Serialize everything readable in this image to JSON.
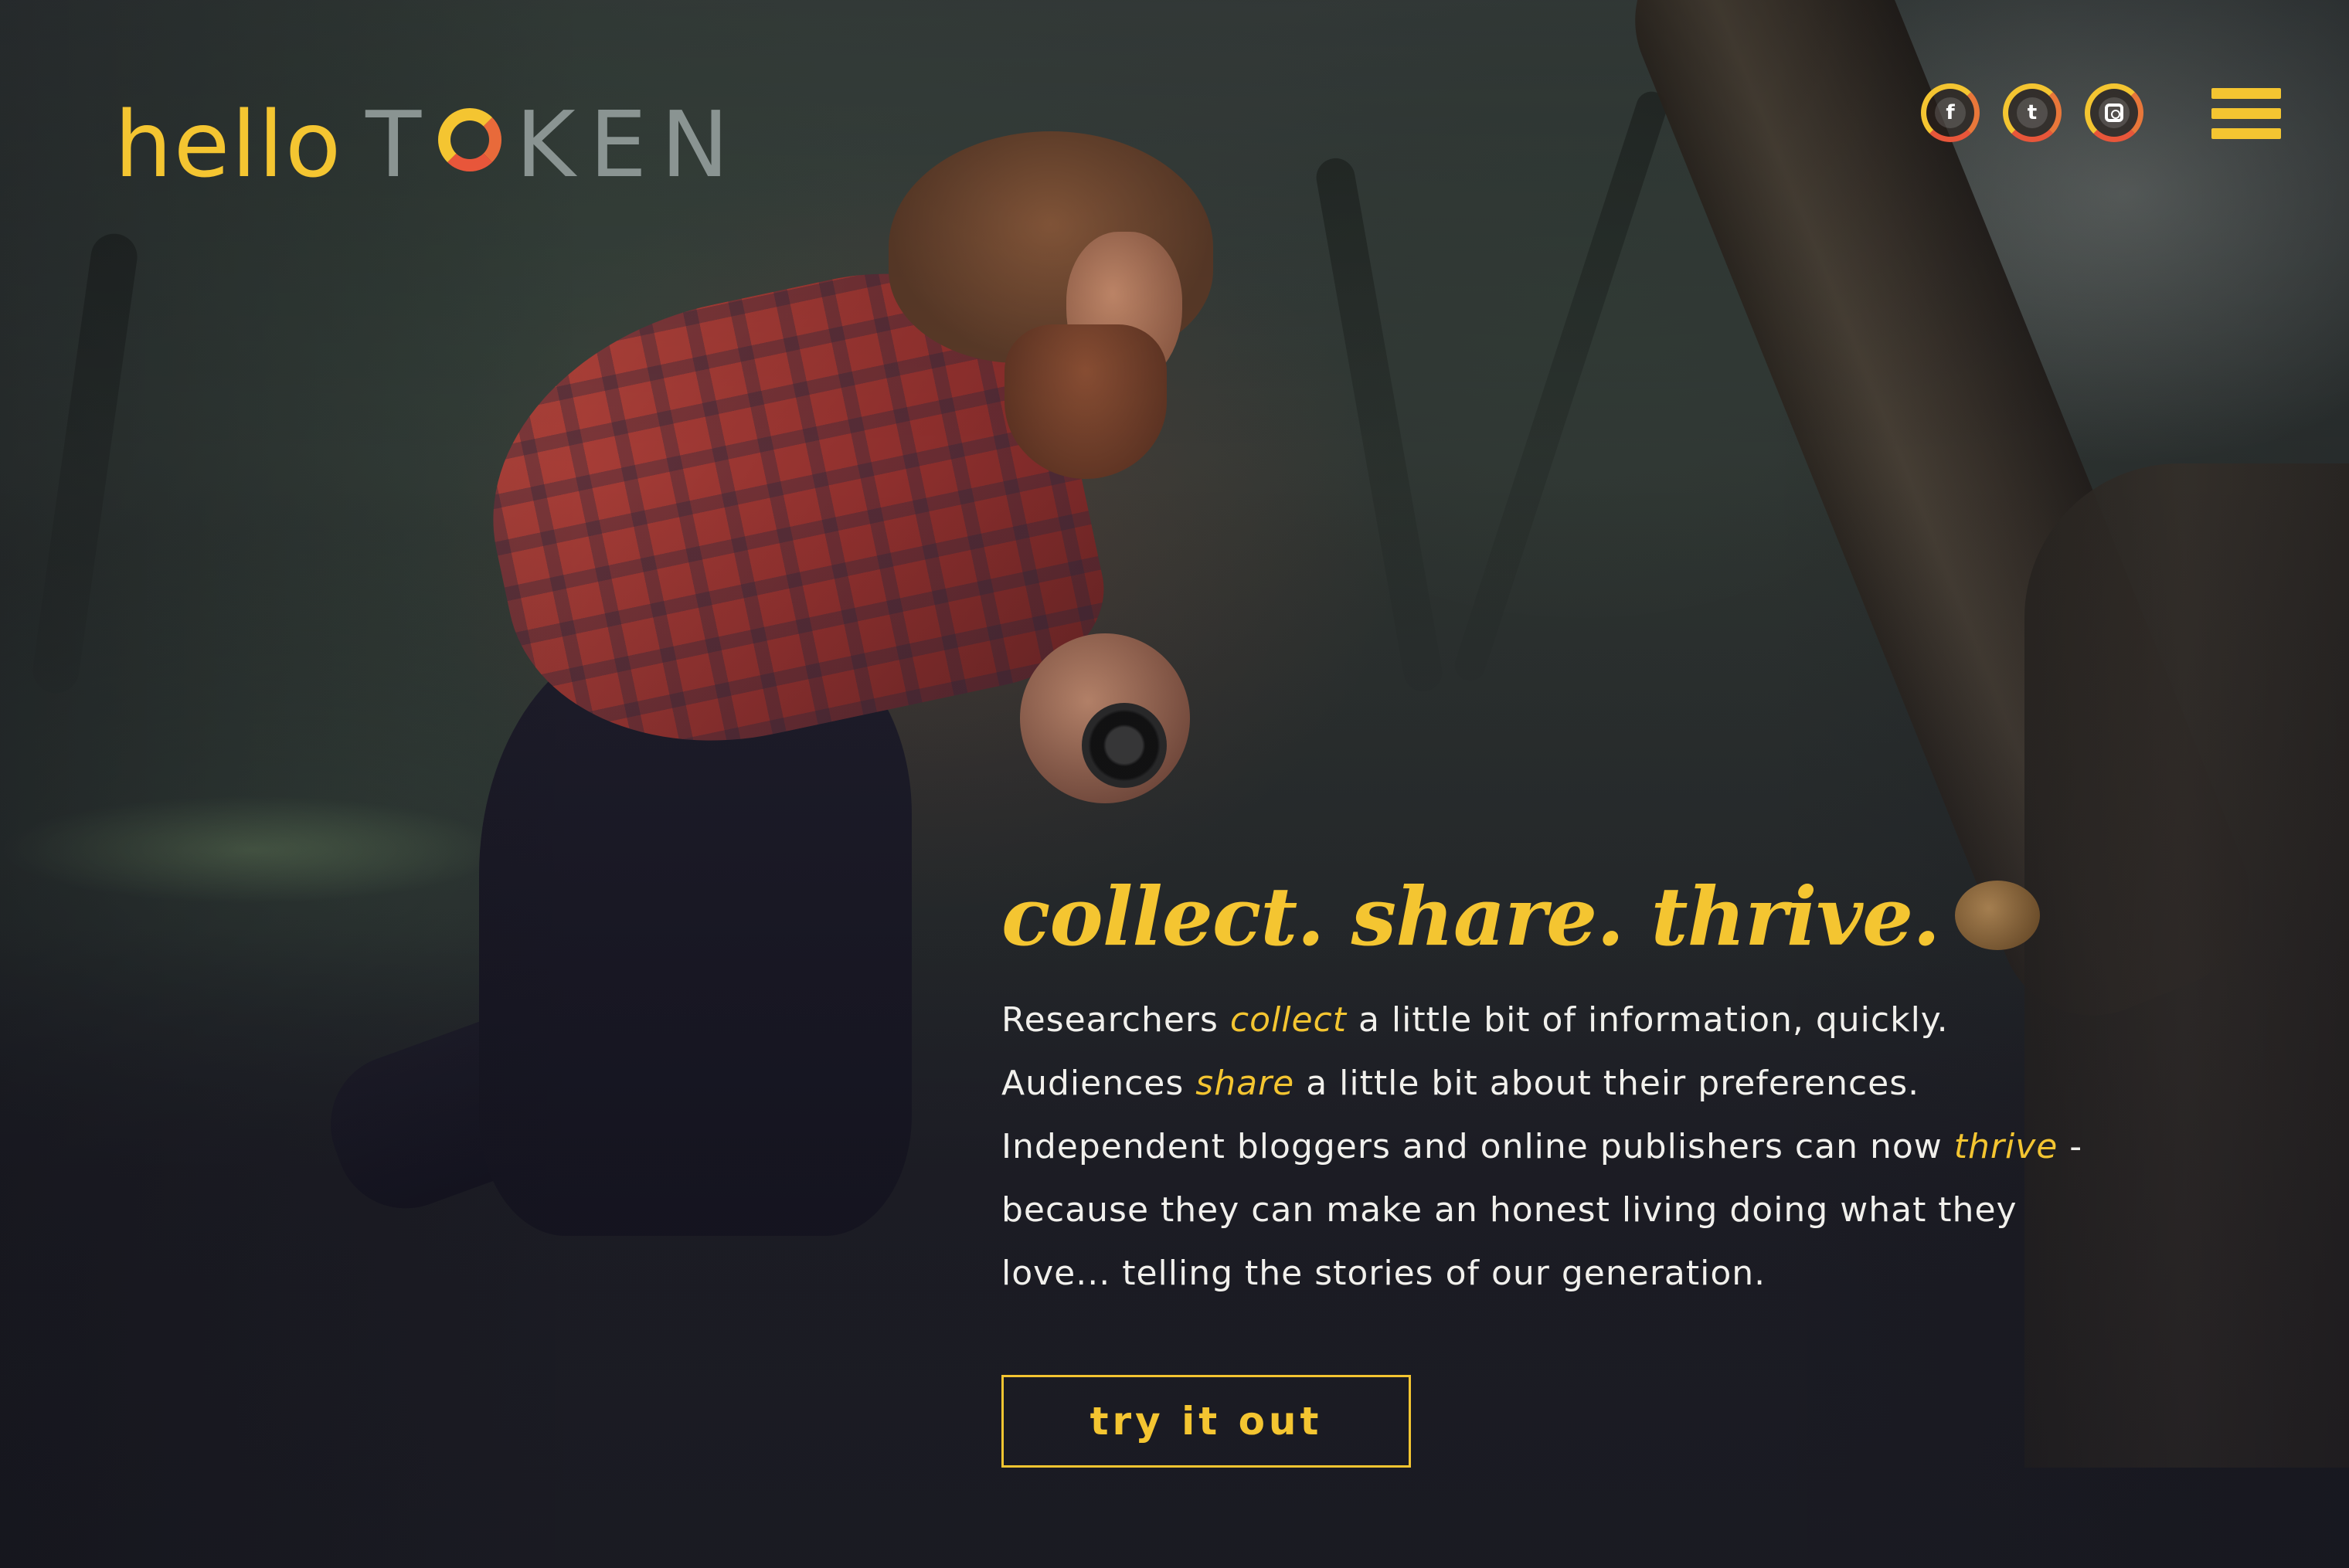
{
  "brand": {
    "hello": "hello",
    "token_t": "T",
    "token_rest": "KEN",
    "colors": {
      "yellow": "#f4c531",
      "gray": "#8a9492",
      "orange": "#e8773a"
    }
  },
  "header": {
    "social": [
      {
        "name": "facebook",
        "icon": "facebook-icon",
        "glyph": "f"
      },
      {
        "name": "twitter",
        "icon": "twitter-icon",
        "glyph": "t"
      },
      {
        "name": "instagram",
        "icon": "instagram-icon",
        "glyph": ""
      }
    ],
    "menu_icon": "hamburger-menu-icon"
  },
  "hero": {
    "headline": "collect. share. thrive.",
    "lines": [
      {
        "before": "Researchers ",
        "em": "collect",
        "after": " a little bit of information, quickly."
      },
      {
        "before": "Audiences ",
        "em": "share",
        "after": " a little bit about their preferences."
      },
      {
        "before": "Independent bloggers and online publishers can now ",
        "em": "thrive",
        "after": " -"
      },
      {
        "before": "because they can make an honest living doing what they",
        "em": "",
        "after": ""
      },
      {
        "before": "love... telling the stories of our generation.",
        "em": "",
        "after": ""
      }
    ],
    "cta_label": "try it out"
  }
}
